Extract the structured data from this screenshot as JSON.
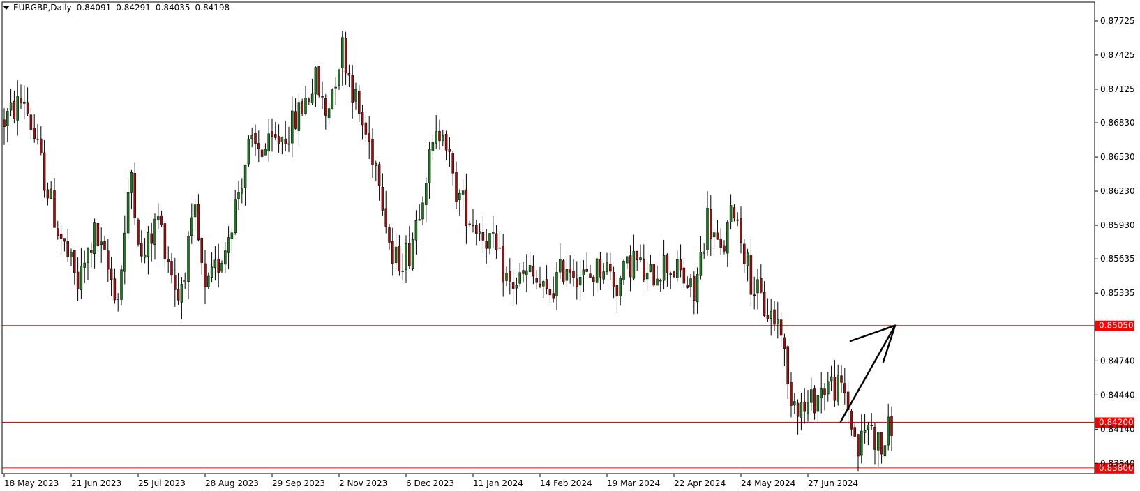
{
  "header": {
    "symbol_timeframe": "EURGBP,Daily",
    "open": "0.84091",
    "high": "0.84291",
    "low": "0.84035",
    "close": "0.84198"
  },
  "chart_data": {
    "type": "candlestick",
    "symbol": "EURGBP",
    "timeframe": "Daily",
    "y_axis_ticks": [
      "0.87725",
      "0.87425",
      "0.87125",
      "0.86830",
      "0.86530",
      "0.86230",
      "0.85930",
      "0.85635",
      "0.85335",
      "0.84740",
      "0.84440",
      "0.84140",
      "0.83840"
    ],
    "ylim": [
      0.8375,
      0.8789
    ],
    "x_axis_labels": [
      "18 May 2023",
      "21 Jun 2023",
      "25 Jul 2023",
      "28 Aug 2023",
      "29 Sep 2023",
      "2 Nov 2023",
      "6 Dec 2023",
      "11 Jan 2024",
      "14 Feb 2024",
      "19 Mar 2024",
      "22 Apr 2024",
      "24 May 2024",
      "27 Jun 2024"
    ],
    "horizontal_levels": [
      {
        "value": 0.8505,
        "label": "0.85050",
        "color": "#ff0000"
      },
      {
        "value": 0.842,
        "label": "0.84200",
        "color": "#ff0000"
      },
      {
        "value": 0.838,
        "label": "0.83800",
        "color": "#ff0000"
      }
    ],
    "price_path_anchors": [
      [
        0,
        0.8685
      ],
      [
        6,
        0.8705
      ],
      [
        12,
        0.8635
      ],
      [
        16,
        0.859
      ],
      [
        22,
        0.854
      ],
      [
        27,
        0.8585
      ],
      [
        34,
        0.853
      ],
      [
        38,
        0.864
      ],
      [
        41,
        0.856
      ],
      [
        46,
        0.86
      ],
      [
        52,
        0.853
      ],
      [
        57,
        0.86
      ],
      [
        60,
        0.853
      ],
      [
        66,
        0.8575
      ],
      [
        73,
        0.866
      ],
      [
        79,
        0.866
      ],
      [
        86,
        0.868
      ],
      [
        93,
        0.872
      ],
      [
        96,
        0.869
      ],
      [
        101,
        0.875
      ],
      [
        106,
        0.869
      ],
      [
        112,
        0.864
      ],
      [
        116,
        0.856
      ],
      [
        121,
        0.857
      ],
      [
        126,
        0.864
      ],
      [
        131,
        0.8685
      ],
      [
        134,
        0.863
      ],
      [
        139,
        0.86
      ],
      [
        145,
        0.858
      ],
      [
        151,
        0.854
      ],
      [
        157,
        0.855
      ],
      [
        162,
        0.853
      ],
      [
        168,
        0.856
      ],
      [
        174,
        0.8545
      ],
      [
        179,
        0.856
      ],
      [
        183,
        0.854
      ],
      [
        188,
        0.8565
      ],
      [
        192,
        0.8545
      ],
      [
        197,
        0.856
      ],
      [
        202,
        0.855
      ],
      [
        206,
        0.853
      ],
      [
        210,
        0.86
      ],
      [
        214,
        0.8565
      ],
      [
        218,
        0.861
      ],
      [
        223,
        0.8545
      ],
      [
        227,
        0.852
      ],
      [
        232,
        0.8505
      ],
      [
        234,
        0.845
      ],
      [
        239,
        0.843
      ],
      [
        246,
        0.8455
      ],
      [
        251,
        0.8445
      ],
      [
        255,
        0.8395
      ],
      [
        258,
        0.842
      ],
      [
        262,
        0.8395
      ],
      [
        265,
        0.842
      ]
    ],
    "annotation": {
      "type": "arrow",
      "from_value": 0.842,
      "to_value": 0.8505,
      "color": "#000000"
    }
  }
}
